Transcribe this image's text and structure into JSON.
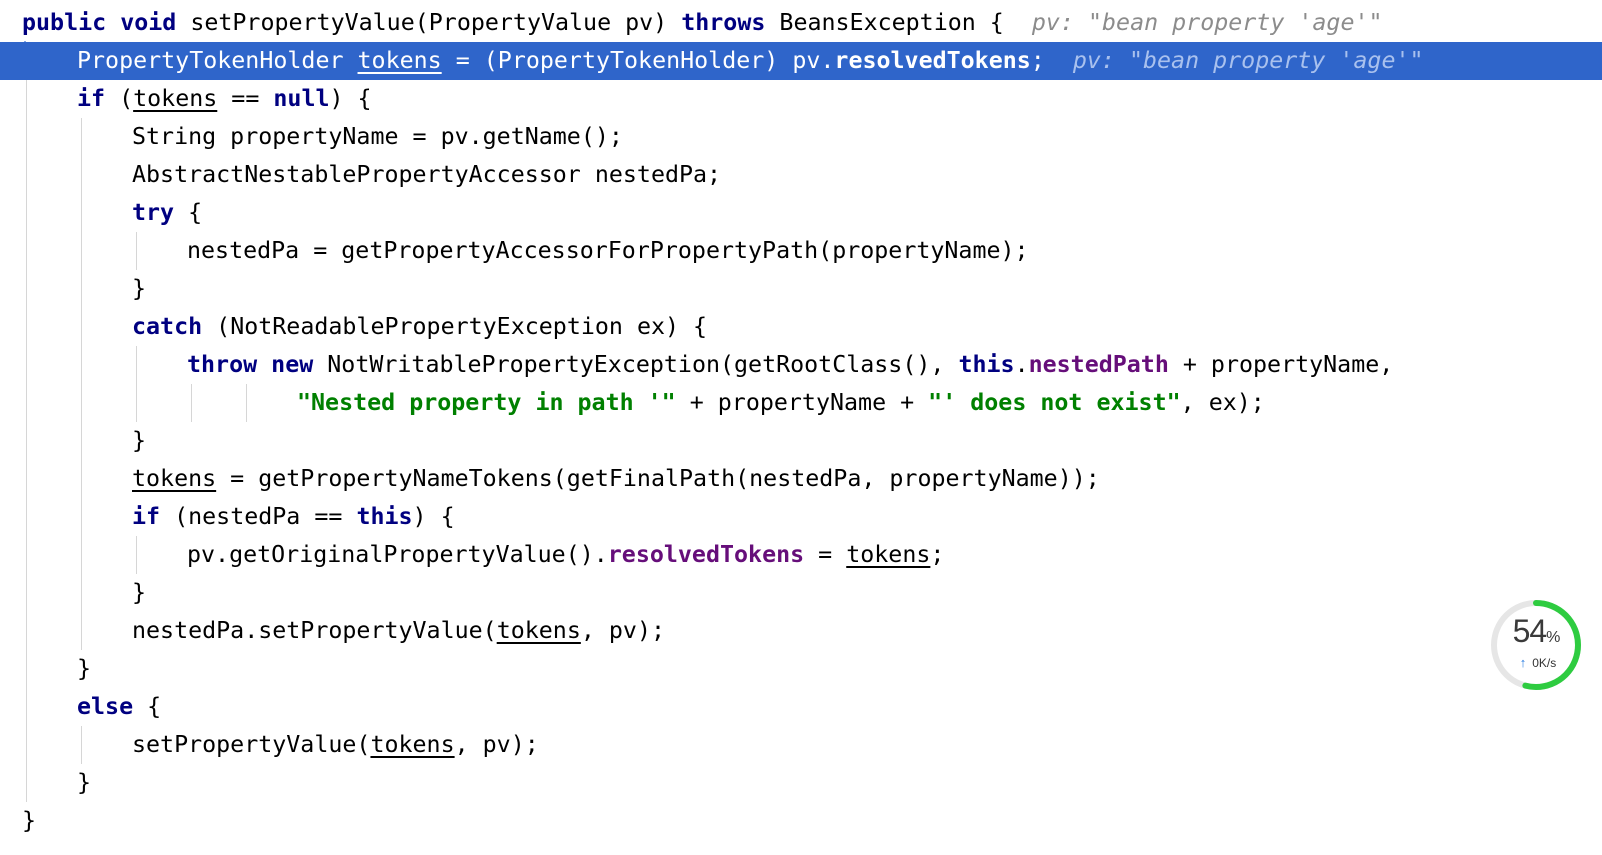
{
  "editor": {
    "lines": [
      {
        "indent": 0,
        "highlighted": false,
        "tokens": [
          {
            "t": "public",
            "k": "kw"
          },
          {
            "t": " "
          },
          {
            "t": "void",
            "k": "kw"
          },
          {
            "t": " setPropertyValue(PropertyValue pv) "
          },
          {
            "t": "throws",
            "k": "kw"
          },
          {
            "t": " BeansException {  "
          },
          {
            "t": "pv: \"bean property 'age'\"",
            "k": "hint"
          }
        ]
      },
      {
        "indent": 1,
        "highlighted": true,
        "tokens": [
          {
            "t": "PropertyTokenHolder "
          },
          {
            "t": "tokens",
            "k": "ul"
          },
          {
            "t": " = (PropertyTokenHolder) pv."
          },
          {
            "t": "resolvedTokens",
            "k": "fld"
          },
          {
            "t": ";  "
          },
          {
            "t": "pv: \"bean property 'age'\"",
            "k": "hint"
          }
        ]
      },
      {
        "indent": 1,
        "highlighted": false,
        "tokens": [
          {
            "t": "if",
            "k": "kw"
          },
          {
            "t": " ("
          },
          {
            "t": "tokens",
            "k": "ul"
          },
          {
            "t": " == "
          },
          {
            "t": "null",
            "k": "kw"
          },
          {
            "t": ") {"
          }
        ]
      },
      {
        "indent": 2,
        "highlighted": false,
        "tokens": [
          {
            "t": "String propertyName = pv.getName();"
          }
        ]
      },
      {
        "indent": 2,
        "highlighted": false,
        "tokens": [
          {
            "t": "AbstractNestablePropertyAccessor nestedPa;"
          }
        ]
      },
      {
        "indent": 2,
        "highlighted": false,
        "tokens": [
          {
            "t": "try",
            "k": "kw"
          },
          {
            "t": " {"
          }
        ]
      },
      {
        "indent": 3,
        "highlighted": false,
        "tokens": [
          {
            "t": "nestedPa = getPropertyAccessorForPropertyPath(propertyName);"
          }
        ]
      },
      {
        "indent": 2,
        "highlighted": false,
        "tokens": [
          {
            "t": "}"
          }
        ]
      },
      {
        "indent": 2,
        "highlighted": false,
        "tokens": [
          {
            "t": "catch",
            "k": "kw"
          },
          {
            "t": " (NotReadablePropertyException ex) {"
          }
        ]
      },
      {
        "indent": 3,
        "highlighted": false,
        "tokens": [
          {
            "t": "throw",
            "k": "kw"
          },
          {
            "t": " "
          },
          {
            "t": "new",
            "k": "kw"
          },
          {
            "t": " NotWritablePropertyException(getRootClass(), "
          },
          {
            "t": "this",
            "k": "kw"
          },
          {
            "t": "."
          },
          {
            "t": "nestedPath",
            "k": "fld"
          },
          {
            "t": " + propertyName,"
          }
        ]
      },
      {
        "indent": 5,
        "highlighted": false,
        "tokens": [
          {
            "t": "\"Nested property in path '\"",
            "k": "str"
          },
          {
            "t": " + propertyName + "
          },
          {
            "t": "\"' does not exist\"",
            "k": "str"
          },
          {
            "t": ", ex);"
          }
        ]
      },
      {
        "indent": 2,
        "highlighted": false,
        "tokens": [
          {
            "t": "}"
          }
        ]
      },
      {
        "indent": 2,
        "highlighted": false,
        "tokens": [
          {
            "t": "tokens",
            "k": "ul"
          },
          {
            "t": " = getPropertyNameTokens(getFinalPath(nestedPa, propertyName));"
          }
        ]
      },
      {
        "indent": 2,
        "highlighted": false,
        "tokens": [
          {
            "t": "if",
            "k": "kw"
          },
          {
            "t": " (nestedPa == "
          },
          {
            "t": "this",
            "k": "kw"
          },
          {
            "t": ") {"
          }
        ]
      },
      {
        "indent": 3,
        "highlighted": false,
        "tokens": [
          {
            "t": "pv.getOriginalPropertyValue()."
          },
          {
            "t": "resolvedTokens",
            "k": "fld"
          },
          {
            "t": " = "
          },
          {
            "t": "tokens",
            "k": "ul"
          },
          {
            "t": ";"
          }
        ]
      },
      {
        "indent": 2,
        "highlighted": false,
        "tokens": [
          {
            "t": "}"
          }
        ]
      },
      {
        "indent": 2,
        "highlighted": false,
        "tokens": [
          {
            "t": "nestedPa.setPropertyValue("
          },
          {
            "t": "tokens",
            "k": "ul"
          },
          {
            "t": ", pv);"
          }
        ]
      },
      {
        "indent": 1,
        "highlighted": false,
        "tokens": [
          {
            "t": "}"
          }
        ]
      },
      {
        "indent": 1,
        "highlighted": false,
        "tokens": [
          {
            "t": "else",
            "k": "kw"
          },
          {
            "t": " {"
          }
        ]
      },
      {
        "indent": 2,
        "highlighted": false,
        "tokens": [
          {
            "t": "setPropertyValue("
          },
          {
            "t": "tokens",
            "k": "ul"
          },
          {
            "t": ", pv);"
          }
        ]
      },
      {
        "indent": 1,
        "highlighted": false,
        "tokens": [
          {
            "t": "}"
          }
        ]
      },
      {
        "indent": 0,
        "highlighted": false,
        "tokens": [
          {
            "t": "}"
          }
        ]
      }
    ]
  },
  "network_widget": {
    "percent": "54",
    "percent_unit": "%",
    "upload_icon": "arrow-up-icon",
    "speed": "0K/s",
    "progress": 0.54,
    "ring_color": "#2ecc40"
  }
}
